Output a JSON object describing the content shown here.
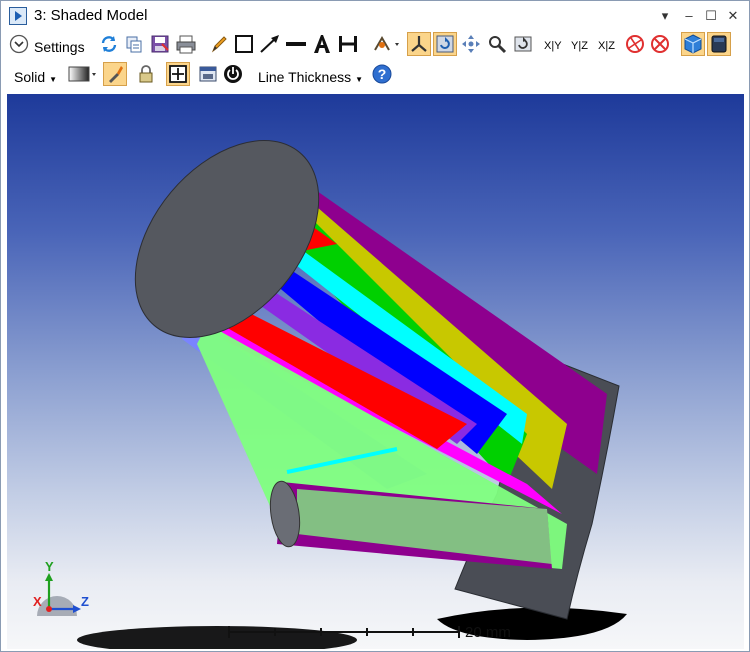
{
  "window": {
    "title": "3: Shaded Model"
  },
  "titlebar_buttons": {
    "dropdown": "▾",
    "minimize": "–",
    "maximize": "☐",
    "close": "✕"
  },
  "toolbar1": {
    "settings_label": "Settings",
    "axis_xy": "X|Y",
    "axis_yz": "Y|Z",
    "axis_xz": "X|Z"
  },
  "toolbar2": {
    "display_mode": "Solid",
    "line_thickness_label": "Line Thickness",
    "help": "?"
  },
  "viewport": {
    "scale_label": "20 mm",
    "axis_x": "X",
    "axis_y": "Y",
    "axis_z": "Z"
  },
  "colors": {
    "accent_active": "#fbd58b",
    "mirror": "#5a5d66",
    "ray_colors": [
      "#7a84ff",
      "#ff0000",
      "#ff00ff",
      "#00ff00",
      "#7fff7f",
      "#0000ff",
      "#c8c800",
      "#8e008e",
      "#00ffff",
      "#8a2be2"
    ]
  }
}
